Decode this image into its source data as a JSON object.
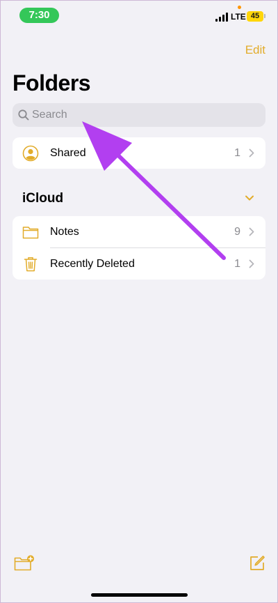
{
  "status_bar": {
    "time": "7:30",
    "network": "LTE",
    "battery": "45"
  },
  "nav": {
    "edit_label": "Edit",
    "title": "Folders"
  },
  "search": {
    "placeholder": "Search"
  },
  "shared": {
    "label": "Shared",
    "count": "1"
  },
  "icloud": {
    "header": "iCloud",
    "items": [
      {
        "label": "Notes",
        "count": "9",
        "icon": "folder-icon"
      },
      {
        "label": "Recently Deleted",
        "count": "1",
        "icon": "trash-icon"
      }
    ]
  },
  "toolbar": {
    "new_folder_icon": "new-folder-icon",
    "compose_icon": "compose-icon"
  },
  "colors": {
    "accent": "#e2ac2a",
    "background": "#f2f1f6",
    "annotation_arrow": "#b23ff0",
    "time_pill": "#34c759",
    "battery": "#ffd60a"
  }
}
